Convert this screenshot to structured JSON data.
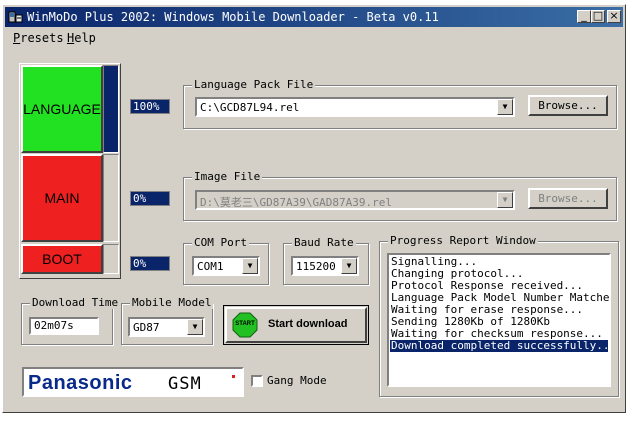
{
  "window": {
    "title": "WinMoDo Plus 2002: Windows Mobile Downloader - Beta v0.11"
  },
  "menu": [
    "Presets",
    "Help"
  ],
  "blocks": [
    {
      "label": "LANGUAGE",
      "color": "#22e022",
      "percent": "100%",
      "progress": 1.0
    },
    {
      "label": "MAIN",
      "color": "#ee2020",
      "percent": "0%",
      "progress": 0
    },
    {
      "label": "BOOT",
      "color": "#ee2020",
      "percent": "0%",
      "progress": 0
    }
  ],
  "language_pack": {
    "label": "Language Pack File",
    "value": "C:\\GCD87L94.rel",
    "browse": "Browse..."
  },
  "image_file": {
    "label": "Image File",
    "value": "D:\\莫老三\\GD87A39\\GAD87A39.rel",
    "browse": "Browse..."
  },
  "com_port": {
    "label": "COM Port",
    "value": "COM1"
  },
  "baud_rate": {
    "label": "Baud Rate",
    "value": "115200"
  },
  "download_time": {
    "label": "Download Time",
    "value": "02m07s"
  },
  "mobile_model": {
    "label": "Mobile Model",
    "value": "GD87"
  },
  "start": {
    "icon_text": "START",
    "label": "Start download"
  },
  "progress_report": {
    "label": "Progress Report Window",
    "lines": [
      "Signalling...",
      "Changing protocol...",
      "Protocol Response received...",
      "Language Pack Model Number Matches...",
      "Waiting for erase response...",
      "Sending 1280Kb of 1280Kb",
      "Waiting for checksum response...",
      "Download completed successfully..."
    ],
    "selected_index": 7
  },
  "logo": {
    "brand": "Panasonic",
    "suffix": "GSM"
  },
  "gang_mode": {
    "label": "Gang Mode",
    "checked": false
  },
  "colors": {
    "titlebar": "#0a246a",
    "face": "#d4d0c8",
    "selection": "#0a246a"
  }
}
